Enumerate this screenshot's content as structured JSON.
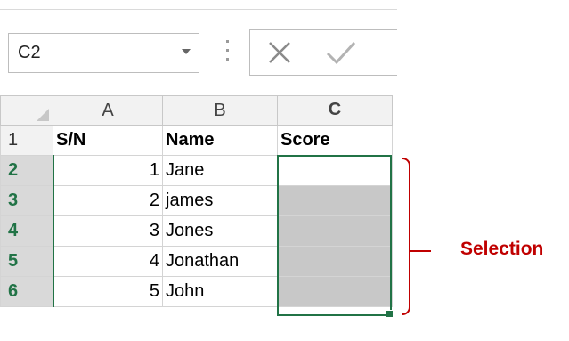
{
  "name_box": {
    "value": "C2"
  },
  "formula_bar": {
    "cancel_icon": "x-icon",
    "enter_icon": "check-icon"
  },
  "grid": {
    "col_headers": [
      "A",
      "B",
      "C"
    ],
    "header_row": {
      "row": "1",
      "a": "S/N",
      "b": "Name",
      "c": "Score"
    },
    "rows": [
      {
        "row": "2",
        "a": "1",
        "b": "Jane",
        "c": ""
      },
      {
        "row": "3",
        "a": "2",
        "b": "james",
        "c": ""
      },
      {
        "row": "4",
        "a": "3",
        "b": "Jones",
        "c": ""
      },
      {
        "row": "5",
        "a": "4",
        "b": "Jonathan",
        "c": ""
      },
      {
        "row": "6",
        "a": "5",
        "b": "John",
        "c": ""
      }
    ],
    "selected_range": "C2:C6",
    "selection_color": "#217346"
  },
  "annotation": {
    "label": "Selection",
    "color": "#c00000"
  }
}
